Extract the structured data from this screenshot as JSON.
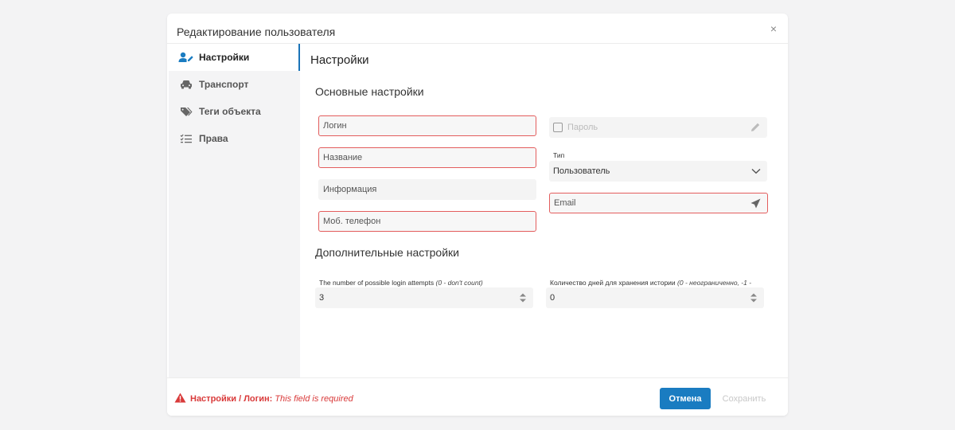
{
  "dialog": {
    "title": "Редактирование пользователя",
    "close_symbol": "×"
  },
  "sidebar": {
    "items": [
      {
        "label": "Настройки",
        "icon": "user-edit-icon",
        "active": true
      },
      {
        "label": "Транспорт",
        "icon": "car-icon",
        "active": false
      },
      {
        "label": "Теги объекта",
        "icon": "tags-icon",
        "active": false
      },
      {
        "label": "Права",
        "icon": "checklist-icon",
        "active": false
      }
    ]
  },
  "content": {
    "title": "Настройки",
    "basic_section": "Основные настройки",
    "fields": {
      "login_placeholder": "Логин",
      "name_placeholder": "Название",
      "info_placeholder": "Информация",
      "phone_placeholder": "Моб. телефон",
      "password_label": "Пароль",
      "type_label": "Тип",
      "type_value": "Пользователь",
      "email_placeholder": "Email"
    },
    "extra_section": "Дополнительные настройки",
    "login_attempts": {
      "label": "The number of possible login attempts",
      "hint": "(0 - don't count)",
      "value": "3"
    },
    "history_days": {
      "label": "Количество дней для хранения истории",
      "hint": "(0 - неограниченно, -1 -",
      "value": "0"
    }
  },
  "footer": {
    "error_path": "Настройки / Логин:",
    "error_text": "This field is required",
    "cancel_label": "Отмена",
    "save_label": "Сохранить"
  },
  "colors": {
    "accent": "#1a7cc1",
    "error": "#e35d5d",
    "sidebar_bg": "#f4f4f5"
  }
}
